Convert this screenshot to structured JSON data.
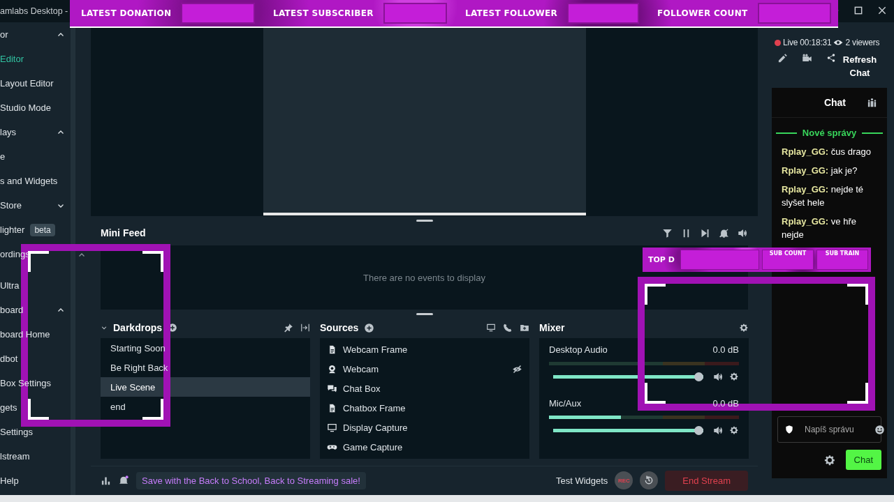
{
  "window": {
    "title": "amlabs Desktop -"
  },
  "overlays": {
    "top_banner": [
      "LATEST DONATION",
      "LATEST SUBSCRIBER",
      "LATEST FOLLOWER",
      "FOLLOWER COUNT"
    ],
    "goal_bar": {
      "label": "TOP D",
      "columns": [
        "SUB COUNT",
        "SUB TRAIN"
      ]
    }
  },
  "sidebar": {
    "items": [
      {
        "label": "or",
        "selected": false,
        "expanded": true
      },
      {
        "label": "Editor",
        "selected": true
      },
      {
        "label": "Layout Editor",
        "selected": false
      },
      {
        "label": "Studio Mode",
        "selected": false
      },
      {
        "label": "lays",
        "selected": false,
        "expanded": true
      },
      {
        "label": "e",
        "selected": false
      },
      {
        "label": "s and Widgets",
        "selected": false
      },
      {
        "label": "Store",
        "selected": false,
        "expanded": false
      },
      {
        "label": "lighter",
        "selected": false,
        "badge": "beta"
      },
      {
        "label": "ordings",
        "selected": false
      }
    ],
    "bottom_items": [
      {
        "label": "Ultra",
        "selected": false
      },
      {
        "label": "board",
        "selected": false,
        "expanded": true
      },
      {
        "label": "board Home",
        "selected": false
      },
      {
        "label": "dbot",
        "selected": false
      },
      {
        "label": "Box Settings",
        "selected": false
      },
      {
        "label": "gets",
        "selected": false
      },
      {
        "label": "Settings",
        "selected": false
      },
      {
        "label": "lstream",
        "selected": false
      },
      {
        "label": "Help",
        "selected": false
      }
    ]
  },
  "mini_feed": {
    "title": "Mini Feed",
    "empty_text": "There are no events to display"
  },
  "scenes": {
    "title": "Darkdrops",
    "items": [
      {
        "label": "Starting Soon",
        "selected": false
      },
      {
        "label": "Be Right Back",
        "selected": false
      },
      {
        "label": "Live Scene",
        "selected": true
      },
      {
        "label": "end",
        "selected": false
      }
    ]
  },
  "sources": {
    "title": "Sources",
    "items": [
      {
        "label": "Webcam Frame",
        "kind": "file",
        "hidden": false
      },
      {
        "label": "Webcam",
        "kind": "webcam",
        "hidden": true
      },
      {
        "label": "Chat Box",
        "kind": "chat",
        "hidden": false
      },
      {
        "label": "Chatbox Frame",
        "kind": "file",
        "hidden": false
      },
      {
        "label": "Display Capture",
        "kind": "display",
        "hidden": false
      },
      {
        "label": "Game Capture",
        "kind": "game",
        "hidden": false
      }
    ]
  },
  "mixer": {
    "title": "Mixer",
    "channels": [
      {
        "name": "Desktop Audio",
        "reading": "0.0 dB",
        "level": 1
      },
      {
        "name": "Mic/Aux",
        "reading": "0.0 dB",
        "meter": {
          "level": 0.38
        },
        "level": 1
      }
    ]
  },
  "footer": {
    "promo": "Save with the Back to School, Back to Streaming sale!",
    "test_widgets": "Test Widgets",
    "rec": "REC",
    "end_stream": "End Stream"
  },
  "live": {
    "status": "Live 00:18:31",
    "viewers": "2 viewers",
    "refresh": "Refresh Chat"
  },
  "chat": {
    "title": "Chat",
    "new_messages": "Nové správy",
    "messages": [
      {
        "user": "Rplay_GG:",
        "text": "čus drago"
      },
      {
        "user": "Rplay_GG:",
        "text": "jak je?"
      },
      {
        "user": "Rplay_GG:",
        "text": "nejde té slyšet hele"
      },
      {
        "user": "Rplay_GG:",
        "text": "ve hře nejde"
      }
    ],
    "placeholder": "Napíš správu",
    "send": "Chat"
  }
}
